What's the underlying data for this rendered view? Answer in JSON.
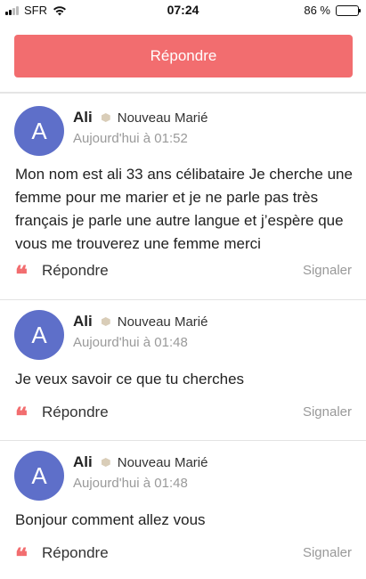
{
  "status_bar": {
    "carrier": "SFR",
    "time": "07:24",
    "battery": "86 %",
    "battery_level": 0.86
  },
  "top": {
    "reply_button": "Répondre"
  },
  "comments": [
    {
      "avatar_letter": "A",
      "author": "Ali",
      "badge": "Nouveau Marié",
      "date": "Aujourd'hui à 01:52",
      "text": "Mon nom est ali 33 ans célibataire Je cherche une femme pour me marier et je ne parle pas très français je parle une autre langue et j’espère que vous me trouverez une femme merci",
      "reply": "Répondre",
      "report": "Signaler"
    },
    {
      "avatar_letter": "A",
      "author": "Ali",
      "badge": "Nouveau Marié",
      "date": "Aujourd'hui à 01:48",
      "text": "Je veux savoir ce que tu cherches",
      "reply": "Répondre",
      "report": "Signaler"
    },
    {
      "avatar_letter": "A",
      "author": "Ali",
      "badge": "Nouveau Marié",
      "date": "Aujourd'hui à 01:48",
      "text": "Bonjour comment allez vous",
      "reply": "Répondre",
      "report": "Signaler"
    }
  ],
  "colors": {
    "accent": "#f26d6f",
    "avatar": "#5e6fc9"
  },
  "icons": {
    "reply": "quote-icon",
    "badge": "hexagon-badge-icon"
  }
}
